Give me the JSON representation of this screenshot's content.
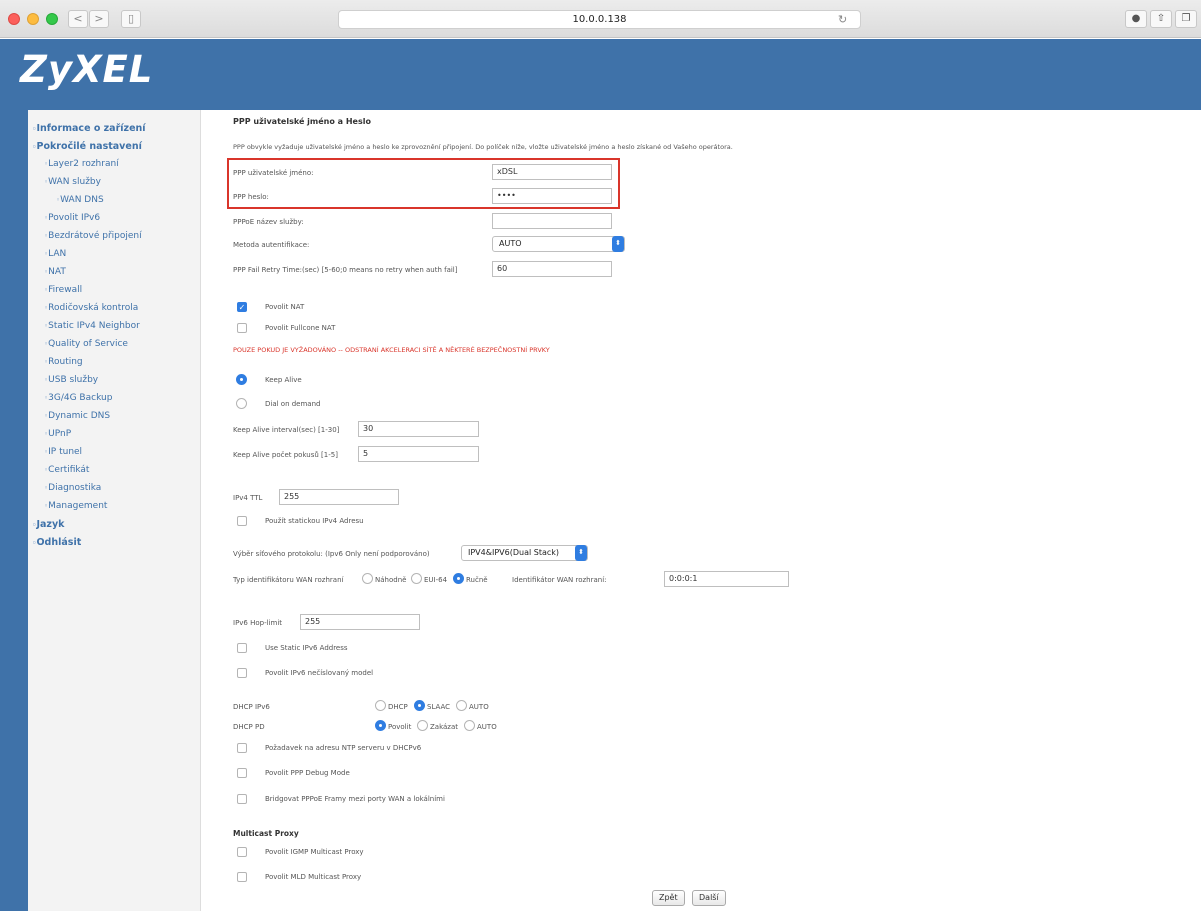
{
  "browser": {
    "url": "10.0.0.138",
    "back": "<",
    "forward": ">",
    "reload": "↻"
  },
  "brand": {
    "logo": "ZyXEL"
  },
  "sidebar": {
    "items": [
      "Informace o zařízení",
      "Pokročilé nastavení",
      "Layer2 rozhraní",
      "WAN služby",
      "WAN DNS",
      "Povolit IPv6",
      "Bezdrátové připojení",
      "LAN",
      "NAT",
      "Firewall",
      "Rodičovská kontrola",
      "Static IPv4 Neighbor",
      "Quality of Service",
      "Routing",
      "USB služby",
      "3G/4G Backup",
      "Dynamic DNS",
      "UPnP",
      "IP tunel",
      "Certifikát",
      "Diagnostika",
      "Management",
      "Jazyk",
      "Odhlásit"
    ]
  },
  "form": {
    "title": "PPP uživatelské jméno a Heslo",
    "intro": "PPP obvykle vyžaduje uživatelské jméno a heslo ke zprovoznění připojení. Do políček níže, vložte uživatelské jméno a heslo získané od Vašeho operátora.",
    "username_label": "PPP uživatelské jméno:",
    "username_value": "xDSL",
    "password_label": "PPP heslo:",
    "password_value": "••••",
    "service_label": "PPPoE název služby:",
    "service_value": "",
    "auth_label": "Metoda autentifikace:",
    "auth_value": "AUTO",
    "retry_label": "PPP Fail Retry Time:(sec) [5-60;0 means no retry when auth fail]",
    "retry_value": "60",
    "nat_label": "Povolit NAT",
    "fullcone_label": "Povolit Fullcone NAT",
    "warning": "POUZE POKUD JE VYŽADOVÁNO -- ODSTRANÍ AKCELERACI SÍTĚ A NĚKTERÉ BEZPEČNOSTNÍ PRVKY",
    "keepalive_label": "Keep Alive",
    "dial_label": "Dial on demand",
    "ka_interval_label": "Keep Alive interval(sec) [1-30]",
    "ka_interval_value": "30",
    "ka_count_label": "Keep Alive počet pokusů [1-5]",
    "ka_count_value": "5",
    "ttl_label": "IPv4 TTL",
    "ttl_value": "255",
    "static_ipv4_label": "Použít statickou IPv4 Adresu",
    "protocol_label": "Výběr síťového protokolu: (Ipv6 Only není podporováno)",
    "protocol_value": "IPV4&IPV6(Dual Stack)",
    "wan_id_type_label": "Typ identifikátoru WAN rozhraní",
    "wan_id_random": "Náhodně",
    "wan_id_eui": "EUI-64",
    "wan_id_manual": "Ručně",
    "wan_id_label": "Identifikátor WAN rozhraní:",
    "wan_id_value": "0:0:0:1",
    "hoplimit_label": "IPv6 Hop-limit",
    "hoplimit_value": "255",
    "static_ipv6_label": "Use Static IPv6 Address",
    "unnumbered_label": "Povolit IPv6 nečíslovaný model",
    "dhcp_ipv6_label": "DHCP IPv6",
    "dhcp_opt_dhcp": "DHCP",
    "dhcp_opt_slaac": "SLAAC",
    "dhcp_opt_auto": "AUTO",
    "dhcp_pd_label": "DHCP PD",
    "pd_opt_enable": "Povolit",
    "pd_opt_disable": "Zakázat",
    "pd_opt_auto": "AUTO",
    "ntp_label": "Požadavek na adresu NTP serveru v DHCPv6",
    "debug_label": "Povolit PPP Debug Mode",
    "bridge_label": "Bridgovat PPPoE Framy mezi porty WAN a lokálními",
    "multicast_title": "Multicast Proxy",
    "igmp_label": "Povolit IGMP Multicast Proxy",
    "mld_label": "Povolit MLD Multicast Proxy",
    "back_button": "Zpět",
    "next_button": "Další"
  }
}
